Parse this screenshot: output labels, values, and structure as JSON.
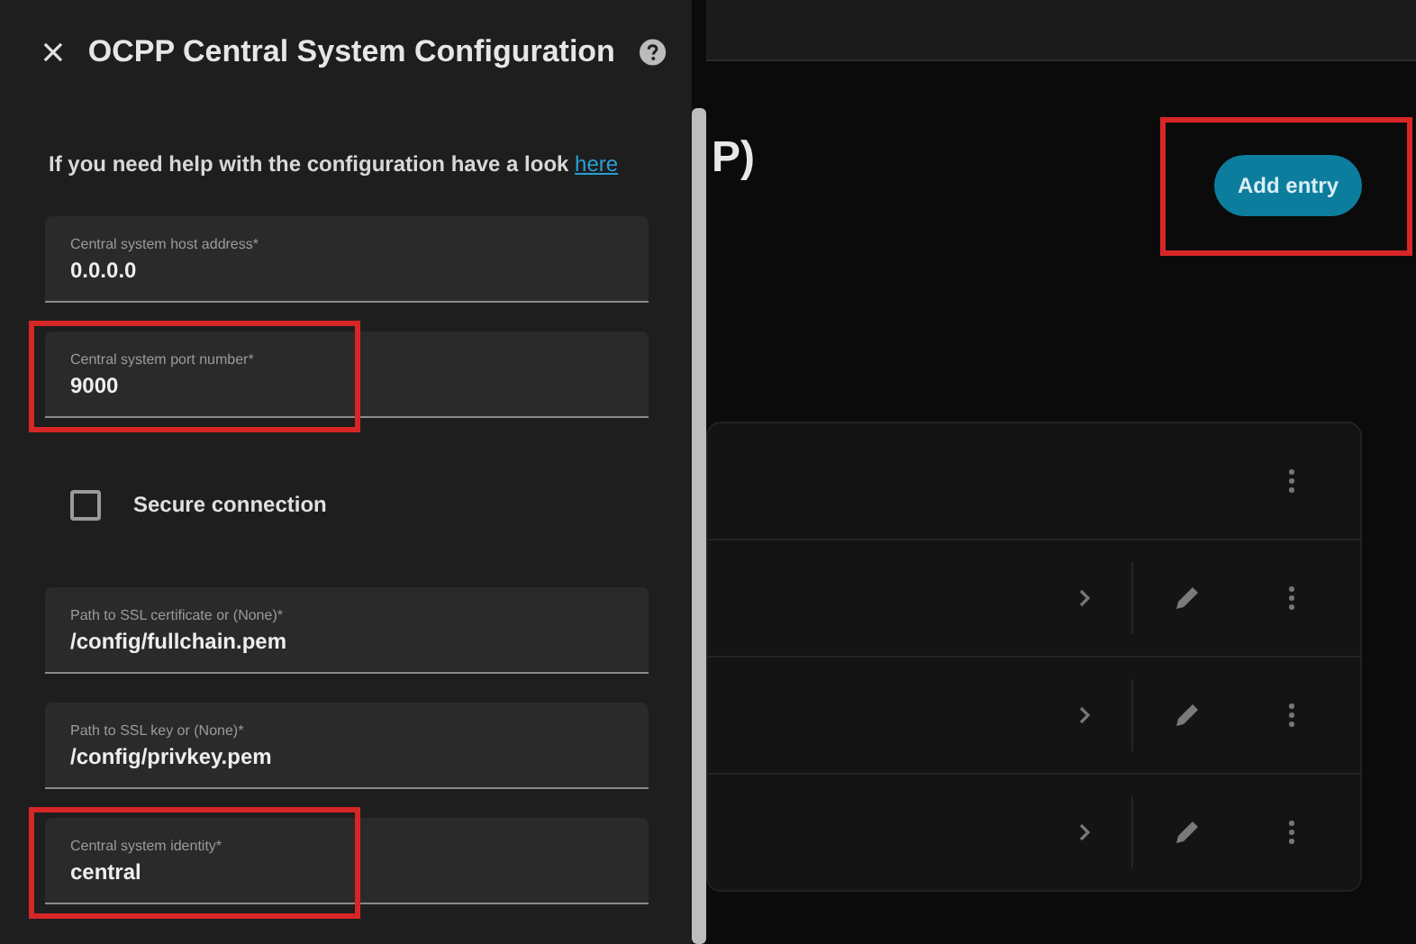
{
  "dialog": {
    "title": "OCPP Central System Configuration",
    "help_text": "If you need help with the configuration have a look",
    "help_link": "here",
    "fields": [
      {
        "kind": "text",
        "label": "Central system host address*",
        "value": "0.0.0.0",
        "highlighted": false
      },
      {
        "kind": "text",
        "label": "Central system port number*",
        "value": "9000",
        "highlighted": true
      },
      {
        "kind": "checkbox",
        "label": "Secure connection",
        "checked": false,
        "highlighted": false
      },
      {
        "kind": "text",
        "label": "Path to SSL certificate or (None)*",
        "value": "/config/fullchain.pem",
        "highlighted": false
      },
      {
        "kind": "text",
        "label": "Path to SSL key or (None)*",
        "value": "/config/privkey.pem",
        "highlighted": false
      },
      {
        "kind": "text",
        "label": "Central system identity*",
        "value": "central",
        "highlighted": true
      }
    ]
  },
  "page": {
    "heading_fragment": "P)",
    "add_button": {
      "label": "Add entry",
      "highlighted": true
    },
    "rows": [
      {
        "kind": "header"
      },
      {
        "kind": "entry"
      },
      {
        "kind": "entry"
      },
      {
        "kind": "entry"
      }
    ]
  }
}
